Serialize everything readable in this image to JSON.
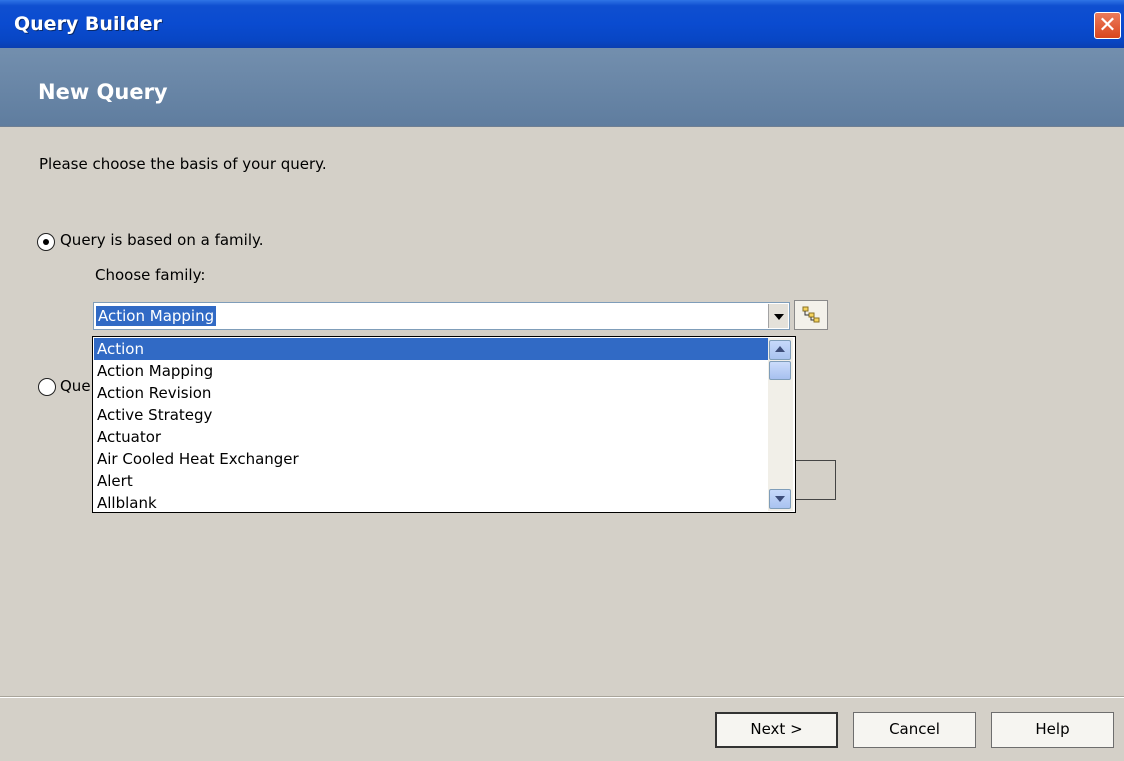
{
  "window": {
    "title": "Query Builder"
  },
  "header": {
    "title": "New Query"
  },
  "content": {
    "prompt": "Please choose the basis of your query.",
    "option_family": {
      "label": "Query is based on a family.",
      "selected": true
    },
    "choose_family_label": "Choose family:",
    "family_combo": {
      "value": "Action Mapping"
    },
    "option_other": {
      "label_partial": "Que",
      "selected": false
    },
    "family_list": {
      "items": [
        "Action",
        "Action Mapping",
        "Action Revision",
        "Active Strategy",
        "Actuator",
        "Air Cooled Heat Exchanger",
        "Alert",
        "Allblank"
      ],
      "highlighted_index": 0
    }
  },
  "footer": {
    "next_label": "Next >",
    "cancel_label": "Cancel",
    "help_label": "Help"
  },
  "colors": {
    "selection": "#316ac5",
    "titlebar": "#0a4bd0",
    "header_band": "#6984a5"
  }
}
